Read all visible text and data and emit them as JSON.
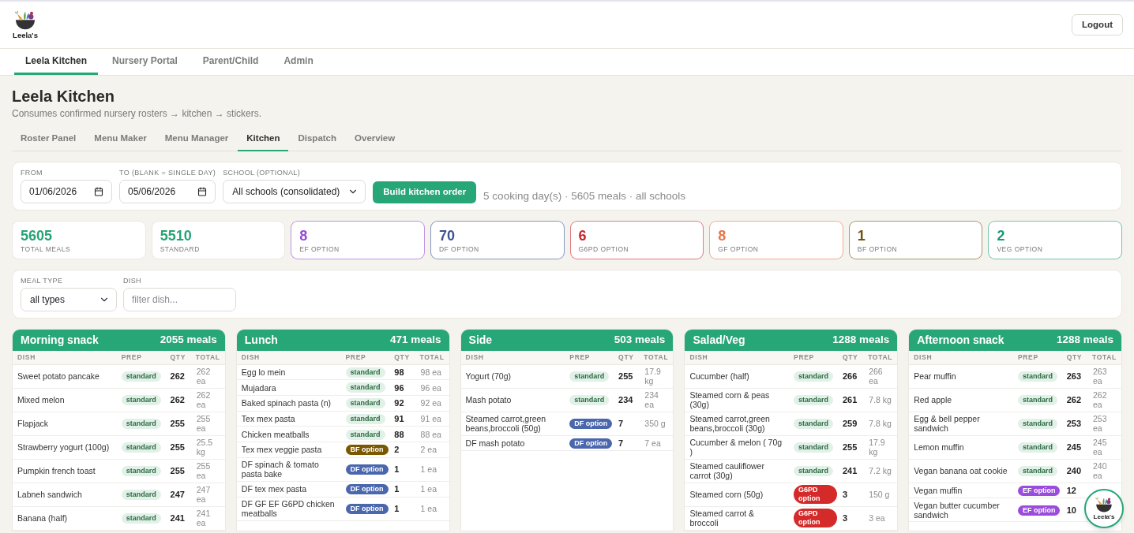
{
  "header": {
    "logo_text": "Leela's",
    "logout": "Logout"
  },
  "nav_tabs": [
    {
      "label": "Leela Kitchen",
      "selected": true
    },
    {
      "label": "Nursery Portal",
      "selected": false
    },
    {
      "label": "Parent/Child",
      "selected": false
    },
    {
      "label": "Admin",
      "selected": false
    }
  ],
  "page": {
    "title": "Leela Kitchen",
    "subtitle": "Consumes confirmed nursery rosters → kitchen → stickers."
  },
  "sub_tabs": [
    {
      "label": "Roster Panel",
      "selected": false
    },
    {
      "label": "Menu Maker",
      "selected": false
    },
    {
      "label": "Menu Manager",
      "selected": false
    },
    {
      "label": "Kitchen",
      "selected": true
    },
    {
      "label": "Dispatch",
      "selected": false
    },
    {
      "label": "Overview",
      "selected": false
    }
  ],
  "order_form": {
    "fields": [
      {
        "kind": "date",
        "label": "FROM",
        "value": "01/06/2026"
      },
      {
        "kind": "date",
        "label": "TO (BLANK = SINGLE DAY)",
        "value": "05/06/2026"
      },
      {
        "kind": "select",
        "label": "SCHOOL (OPTIONAL)",
        "value": "All schools (consolidated)"
      }
    ],
    "button": "Build kitchen order",
    "summary": "5 cooking day(s) · 5605 meals · all schools"
  },
  "stats": [
    {
      "value": "5605",
      "label": "TOTAL MEALS",
      "color": "#27a477",
      "outlined": false
    },
    {
      "value": "5510",
      "label": "STANDARD",
      "color": "#27a477",
      "outlined": false
    },
    {
      "value": "8",
      "label": "EF OPTION",
      "color": "#9747d6",
      "outlined": true
    },
    {
      "value": "70",
      "label": "DF OPTION",
      "color": "#3b5296",
      "outlined": true
    },
    {
      "value": "6",
      "label": "G6PD OPTION",
      "color": "#c9252b",
      "outlined": true
    },
    {
      "value": "8",
      "label": "GF OPTION",
      "color": "#e8744a",
      "outlined": true
    },
    {
      "value": "1",
      "label": "BF OPTION",
      "color": "#6e5410",
      "outlined": true
    },
    {
      "value": "2",
      "label": "VEG OPTION",
      "color": "#179c78",
      "outlined": true
    }
  ],
  "meal_filters": {
    "fields": [
      {
        "kind": "select",
        "label": "MEAL TYPE",
        "value": "all types"
      },
      {
        "kind": "text",
        "label": "DISH",
        "placeholder": "filter dish..."
      }
    ]
  },
  "meal_tables": [
    {
      "title": "Morning snack",
      "count": "2055 meals",
      "columns": [
        "DISH",
        "PREP",
        "QTY",
        "TOTAL"
      ],
      "rows": [
        {
          "dish": "Sweet potato pancake",
          "prep": {
            "label": "standard",
            "kind": "standard"
          },
          "qty": "262",
          "total": "262 ea"
        },
        {
          "dish": "Mixed melon",
          "prep": {
            "label": "standard",
            "kind": "standard"
          },
          "qty": "262",
          "total": "262 ea"
        },
        {
          "dish": "Flapjack",
          "prep": {
            "label": "standard",
            "kind": "standard"
          },
          "qty": "255",
          "total": "255 ea"
        },
        {
          "dish": "Strawberry yogurt (100g)",
          "prep": {
            "label": "standard",
            "kind": "standard"
          },
          "qty": "255",
          "total": "25.5 kg"
        },
        {
          "dish": "Pumpkin french toast",
          "prep": {
            "label": "standard",
            "kind": "standard"
          },
          "qty": "255",
          "total": "255 ea"
        },
        {
          "dish": "Labneh sandwich",
          "prep": {
            "label": "standard",
            "kind": "standard"
          },
          "qty": "247",
          "total": "247 ea"
        },
        {
          "dish": "Banana (half)",
          "prep": {
            "label": "standard",
            "kind": "standard"
          },
          "qty": "241",
          "total": "241 ea"
        }
      ]
    },
    {
      "title": "Lunch",
      "count": "471 meals",
      "columns": [
        "DISH",
        "PREP",
        "QTY",
        "TOTAL"
      ],
      "rows": [
        {
          "dish": "Egg lo mein",
          "prep": {
            "label": "standard",
            "kind": "standard"
          },
          "qty": "98",
          "total": "98 ea"
        },
        {
          "dish": "Mujadara",
          "prep": {
            "label": "standard",
            "kind": "standard"
          },
          "qty": "96",
          "total": "96 ea"
        },
        {
          "dish": "Baked spinach pasta (n)",
          "prep": {
            "label": "standard",
            "kind": "standard"
          },
          "qty": "92",
          "total": "92 ea"
        },
        {
          "dish": "Tex mex pasta",
          "prep": {
            "label": "standard",
            "kind": "standard"
          },
          "qty": "91",
          "total": "91 ea"
        },
        {
          "dish": "Chicken meatballs",
          "prep": {
            "label": "standard",
            "kind": "standard"
          },
          "qty": "88",
          "total": "88 ea"
        },
        {
          "dish": "Tex mex veggie pasta",
          "prep": {
            "label": "BF option",
            "kind": "bf"
          },
          "qty": "2",
          "total": "2 ea"
        },
        {
          "dish": "DF spinach & tomato pasta bake",
          "prep": {
            "label": "DF option",
            "kind": "df"
          },
          "qty": "1",
          "total": "1 ea"
        },
        {
          "dish": "DF tex mex pasta",
          "prep": {
            "label": "DF option",
            "kind": "df"
          },
          "qty": "1",
          "total": "1 ea"
        },
        {
          "dish": "DF GF EF G6PD chicken meatballs",
          "prep": {
            "label": "DF option",
            "kind": "df"
          },
          "qty": "1",
          "total": "1 ea"
        }
      ]
    },
    {
      "title": "Side",
      "count": "503 meals",
      "columns": [
        "DISH",
        "PREP",
        "QTY",
        "TOTAL"
      ],
      "rows": [
        {
          "dish": "Yogurt (70g)",
          "prep": {
            "label": "standard",
            "kind": "standard"
          },
          "qty": "255",
          "total": "17.9 kg"
        },
        {
          "dish": "Mash potato",
          "prep": {
            "label": "standard",
            "kind": "standard"
          },
          "qty": "234",
          "total": "234 ea"
        },
        {
          "dish": "Steamed carrot,green beans,broccoli (50g)",
          "prep": {
            "label": "DF option",
            "kind": "df"
          },
          "qty": "7",
          "total": "350 g"
        },
        {
          "dish": "DF mash potato",
          "prep": {
            "label": "DF option",
            "kind": "df"
          },
          "qty": "7",
          "total": "7 ea"
        }
      ]
    },
    {
      "title": "Salad/Veg",
      "count": "1288 meals",
      "columns": [
        "DISH",
        "PREP",
        "QTY",
        "TOTAL"
      ],
      "rows": [
        {
          "dish": "Cucumber (half)",
          "prep": {
            "label": "standard",
            "kind": "standard"
          },
          "qty": "266",
          "total": "266 ea"
        },
        {
          "dish": "Steamed corn & peas (30g)",
          "prep": {
            "label": "standard",
            "kind": "standard"
          },
          "qty": "261",
          "total": "7.8 kg"
        },
        {
          "dish": "Steamed carrot,green beans,broccoli (30g)",
          "prep": {
            "label": "standard",
            "kind": "standard"
          },
          "qty": "259",
          "total": "7.8 kg"
        },
        {
          "dish": "Cucumber & melon ( 70g )",
          "prep": {
            "label": "standard",
            "kind": "standard"
          },
          "qty": "255",
          "total": "17.9 kg"
        },
        {
          "dish": "Steamed cauliflower carrot (30g)",
          "prep": {
            "label": "standard",
            "kind": "standard"
          },
          "qty": "241",
          "total": "7.2 kg"
        },
        {
          "dish": "Steamed corn (50g)",
          "prep": {
            "label": "G6PD option",
            "kind": "g6pd"
          },
          "qty": "3",
          "total": "150 g"
        },
        {
          "dish": "Steamed carrot & broccoli",
          "prep": {
            "label": "G6PD option",
            "kind": "g6pd"
          },
          "qty": "3",
          "total": "3 ea"
        }
      ]
    },
    {
      "title": "Afternoon snack",
      "count": "1288 meals",
      "columns": [
        "DISH",
        "PREP",
        "QTY",
        "TOTAL"
      ],
      "rows": [
        {
          "dish": "Pear muffin",
          "prep": {
            "label": "standard",
            "kind": "standard"
          },
          "qty": "263",
          "total": "263 ea"
        },
        {
          "dish": "Red apple",
          "prep": {
            "label": "standard",
            "kind": "standard"
          },
          "qty": "262",
          "total": "262 ea"
        },
        {
          "dish": "Egg & bell pepper sandwich",
          "prep": {
            "label": "standard",
            "kind": "standard"
          },
          "qty": "253",
          "total": "253 ea"
        },
        {
          "dish": "Lemon muffin",
          "prep": {
            "label": "standard",
            "kind": "standard"
          },
          "qty": "245",
          "total": "245 ea"
        },
        {
          "dish": "Vegan banana oat cookie",
          "prep": {
            "label": "standard",
            "kind": "standard"
          },
          "qty": "240",
          "total": "240 ea"
        },
        {
          "dish": "Vegan muffin",
          "prep": {
            "label": "EF option",
            "kind": "ef"
          },
          "qty": "12"
        },
        {
          "dish": "Vegan butter cucumber sandwich",
          "prep": {
            "label": "EF option",
            "kind": "ef"
          },
          "qty": "10"
        }
      ]
    }
  ],
  "floating_button": {
    "label": "Leela's"
  }
}
